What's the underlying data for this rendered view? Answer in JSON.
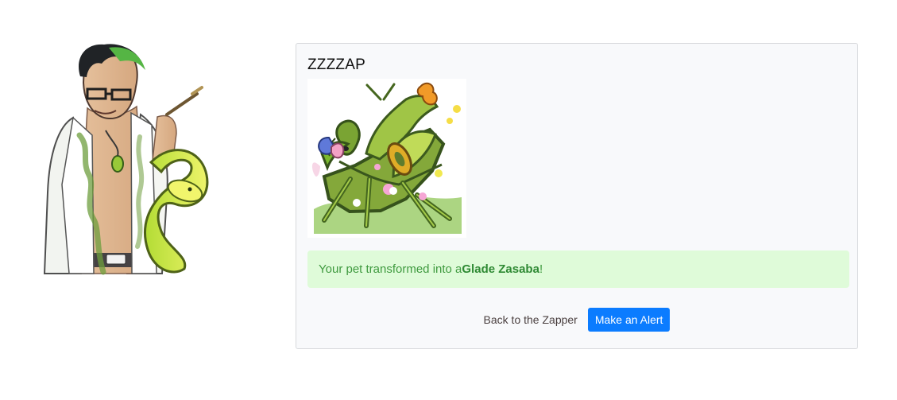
{
  "npc": {
    "icon": "scientist-portrait-illustration"
  },
  "card": {
    "title": "ZZZZAP",
    "pet_image_icon": "green-mantis-pet-illustration"
  },
  "alert": {
    "prefix": "Your pet transformed into a ",
    "pet_name": "Glade Zasaba",
    "suffix": "!"
  },
  "actions": {
    "back_label": "Back to the Zapper",
    "alert_button_label": "Make an Alert"
  },
  "colors": {
    "card_background": "#f8f9fb",
    "alert_background": "#dffbd9",
    "alert_text": "#3f9a3f",
    "primary_button": "#0b7cff"
  }
}
